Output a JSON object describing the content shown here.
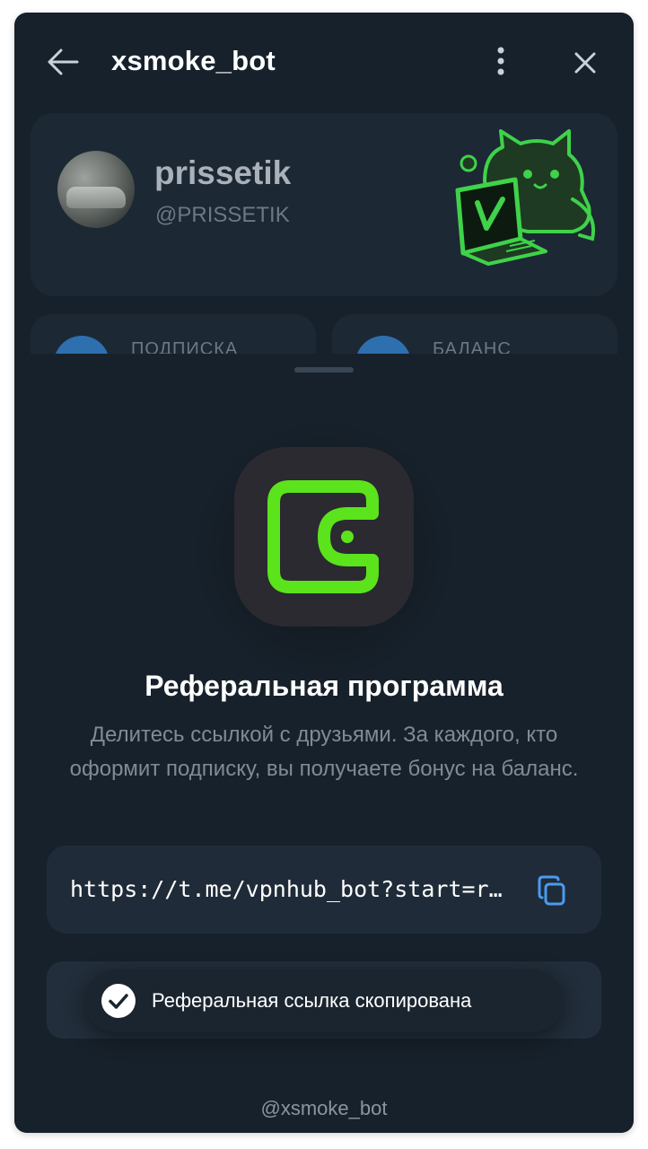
{
  "header": {
    "title": "xsmoke_bot",
    "back_icon": "arrow-left-icon",
    "more_icon": "more-vertical-icon",
    "close_icon": "close-icon"
  },
  "profile": {
    "name": "prissetik",
    "handle": "@PRISSETIK",
    "mascot_icon": "cat-laptop-logo"
  },
  "stats": [
    {
      "label": "ПОДПИСКА"
    },
    {
      "label": "БАЛАНС"
    }
  ],
  "sheet": {
    "icon": "wallet-icon",
    "title": "Реферальная программа",
    "description": "Делитесь ссылкой с друзьями. За каждого, кто оформит подписку, вы получаете бонус на баланс.",
    "link": "https://t.me/vpnhub_bot?start=ref",
    "copy_icon": "copy-icon"
  },
  "toast": {
    "text": "Реферальная ссылка скопирована",
    "icon": "check-circle-icon"
  },
  "footer": {
    "handle": "@xsmoke_bot"
  },
  "colors": {
    "background": "#17212b",
    "card": "#1c2834",
    "accent_green": "#5be31c",
    "accent_blue": "#2e6fb0",
    "link_blue": "#4a9bf0"
  }
}
